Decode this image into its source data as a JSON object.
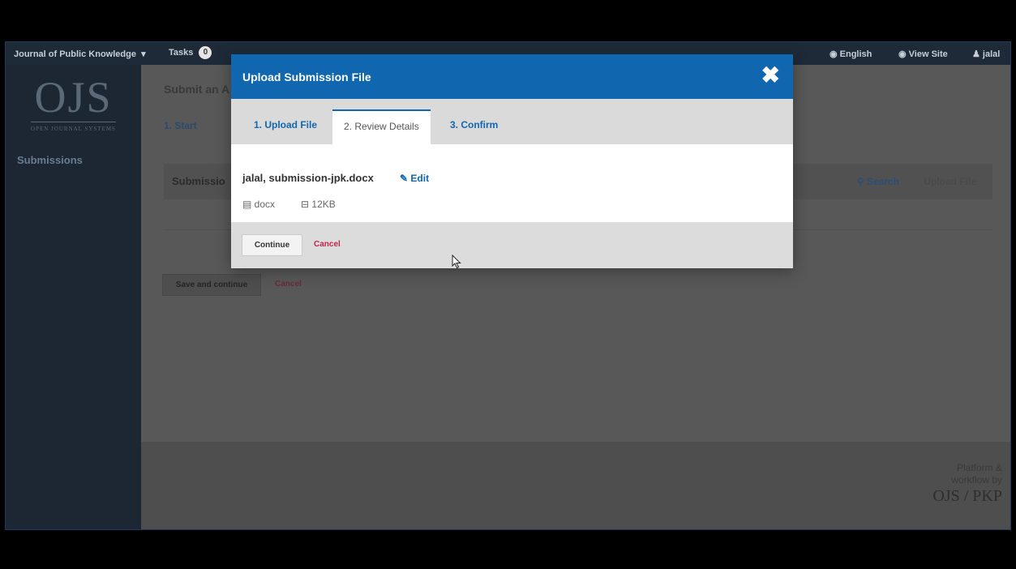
{
  "topbar": {
    "journal": "Journal of Public Knowledge",
    "tasks_label": "Tasks",
    "tasks_count": "0",
    "language": "English",
    "view_site": "View Site",
    "user": "jalal"
  },
  "sidebar": {
    "logo_text": "OJS",
    "logo_subtitle": "OPEN JOURNAL SYSTEMS",
    "items": [
      {
        "label": "Submissions"
      }
    ]
  },
  "main": {
    "title": "Submit an A",
    "step_tab": "1. Start",
    "panel_title": "Submissio",
    "search": "Search",
    "upload_file": "Upload File",
    "save_continue": "Save and continue",
    "cancel": "Cancel"
  },
  "footer": {
    "line1": "Platform &",
    "line2": "workflow by",
    "brand": "OJS / PKP"
  },
  "modal": {
    "title": "Upload Submission File",
    "close": "✖",
    "tabs": [
      {
        "label": "1. Upload File"
      },
      {
        "label": "2. Review Details"
      },
      {
        "label": "3. Confirm"
      }
    ],
    "active_tab": 1,
    "file_name": "jalal, submission-jpk.docx",
    "edit": "Edit",
    "file_type": "docx",
    "file_size": "12KB",
    "continue": "Continue",
    "cancel": "Cancel"
  },
  "colors": {
    "accent": "#1166b0",
    "cancel": "#c0264b",
    "nav_bg": "#1c2733"
  }
}
